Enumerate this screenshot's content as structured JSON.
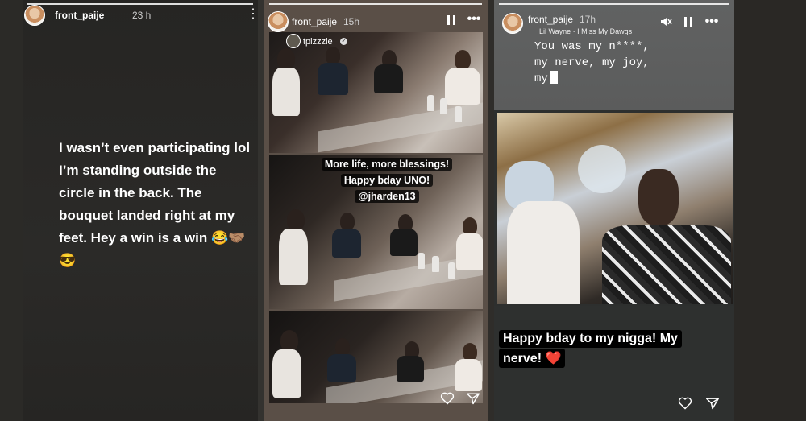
{
  "story1": {
    "username": "front_paije",
    "time": "23 h",
    "caption": "I wasn’t even participating lol I’m standing outside the circle in the back. The bouquet landed right at my feet. Hey a win is a win 😂🤝🏽😎"
  },
  "story2": {
    "username": "front_paije",
    "time": "15h",
    "tagged_user": "tpizzzle",
    "overlay_line1": "More life, more blessings!",
    "overlay_line2": "Happy bday UNO!",
    "overlay_line3": "@jharden13"
  },
  "story3": {
    "username": "front_paije",
    "time": "17h",
    "music": "Lil Wayne · I Miss My Dawgs",
    "lyric_line1": "You was my n****,",
    "lyric_line2": "my nerve, my joy,",
    "lyric_line3": "my",
    "caption_line1": "Happy bday to my nigga! My",
    "caption_line2": "nerve! ❤️"
  },
  "colors": {
    "heart_red": "#e0243a",
    "accent_white": "#ffffff"
  },
  "icons": [
    "more-icon",
    "pause-icon",
    "mute-icon",
    "heart-icon",
    "send-icon",
    "verified-icon"
  ]
}
